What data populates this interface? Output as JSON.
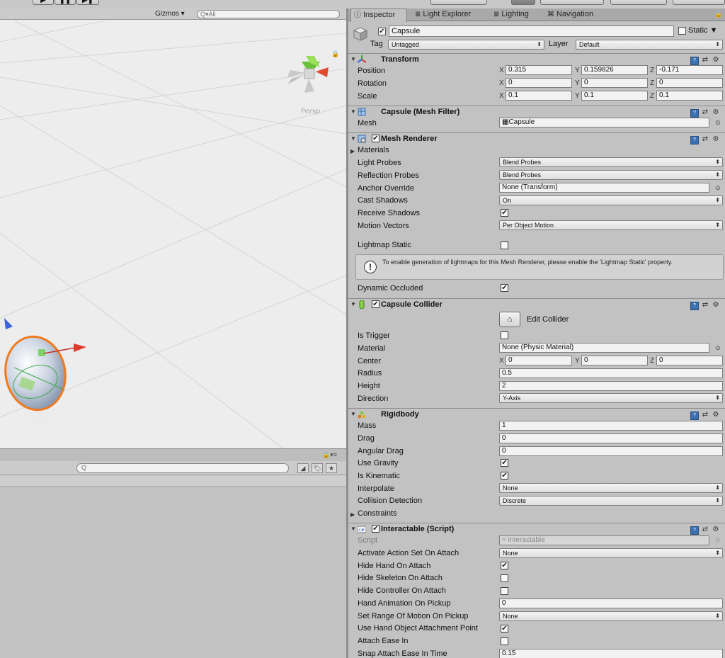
{
  "toolbar": {
    "play": "▶",
    "pause": "❚❚",
    "step": "▶❚"
  },
  "scene": {
    "gizmos_label": "Gizmos ▾",
    "search_placeholder": "All",
    "search_prefix": "Q▾",
    "persp_label": "Persp",
    "panel_menu": "▾≡"
  },
  "lower": {
    "lock": "🔒▾≡",
    "search_placeholder": "",
    "icons": [
      "◢",
      "🏷",
      "★"
    ]
  },
  "inspector": {
    "tabs": [
      {
        "icon": "ⓘ",
        "label": "Inspector"
      },
      {
        "icon": "≣",
        "label": "Light Explorer"
      },
      {
        "icon": "≣",
        "label": "Lighting"
      },
      {
        "icon": "⌘",
        "label": "Navigation"
      }
    ],
    "lock_icon": "🔒",
    "object": {
      "name": "Capsule",
      "active": true,
      "static_label": "Static",
      "static_checked": false,
      "tag_label": "Tag",
      "tag_value": "Untagged",
      "layer_label": "Layer",
      "layer_value": "Default"
    },
    "transform": {
      "title": "Transform",
      "position_label": "Position",
      "rotation_label": "Rotation",
      "scale_label": "Scale",
      "position": {
        "x": "0.315",
        "y": "0.159826",
        "z": "-0.171"
      },
      "rotation": {
        "x": "0",
        "y": "0",
        "z": "0"
      },
      "scale": {
        "x": "0.1",
        "y": "0.1",
        "z": "0.1"
      },
      "axis_x": "X",
      "axis_y": "Y",
      "axis_z": "Z"
    },
    "mesh_filter": {
      "title": "Capsule (Mesh Filter)",
      "mesh_label": "Mesh",
      "mesh_value": "Capsule"
    },
    "mesh_renderer": {
      "title": "Mesh Renderer",
      "enabled": true,
      "materials_label": "Materials",
      "light_probes_label": "Light Probes",
      "light_probes_value": "Blend Probes",
      "reflection_probes_label": "Reflection Probes",
      "reflection_probes_value": "Blend Probes",
      "anchor_override_label": "Anchor Override",
      "anchor_override_value": "None (Transform)",
      "cast_shadows_label": "Cast Shadows",
      "cast_shadows_value": "On",
      "receive_shadows_label": "Receive Shadows",
      "receive_shadows": true,
      "motion_vectors_label": "Motion Vectors",
      "motion_vectors_value": "Per Object Motion",
      "lightmap_static_label": "Lightmap Static",
      "lightmap_static": false,
      "help_text": "To enable generation of lightmaps for this Mesh Renderer, please enable the 'Lightmap Static' property.",
      "dynamic_occluded_label": "Dynamic Occluded",
      "dynamic_occluded": true
    },
    "capsule_collider": {
      "title": "Capsule Collider",
      "enabled": true,
      "edit_collider_label": "Edit Collider",
      "is_trigger_label": "Is Trigger",
      "is_trigger": false,
      "material_label": "Material",
      "material_value": "None (Physic Material)",
      "center_label": "Center",
      "center": {
        "x": "0",
        "y": "0",
        "z": "0"
      },
      "radius_label": "Radius",
      "radius_value": "0.5",
      "height_label": "Height",
      "height_value": "2",
      "direction_label": "Direction",
      "direction_value": "Y-Axis"
    },
    "rigidbody": {
      "title": "Rigidbody",
      "mass_label": "Mass",
      "mass_value": "1",
      "drag_label": "Drag",
      "drag_value": "0",
      "angular_drag_label": "Angular Drag",
      "angular_drag_value": "0",
      "use_gravity_label": "Use Gravity",
      "use_gravity": true,
      "is_kinematic_label": "Is Kinematic",
      "is_kinematic": true,
      "interpolate_label": "Interpolate",
      "interpolate_value": "None",
      "collision_detection_label": "Collision Detection",
      "collision_detection_value": "Discrete",
      "constraints_label": "Constraints"
    },
    "interactable": {
      "title": "Interactable (Script)",
      "enabled": true,
      "script_label": "Script",
      "script_value": "Interactable",
      "activate_action_label": "Activate Action Set On Attach",
      "activate_action_value": "None",
      "hide_hand_label": "Hide Hand On Attach",
      "hide_hand": true,
      "hide_skeleton_label": "Hide Skeleton On Attach",
      "hide_skeleton": false,
      "hide_controller_label": "Hide Controller On Attach",
      "hide_controller": false,
      "hand_anim_label": "Hand Animation On Pickup",
      "hand_anim_value": "0",
      "range_motion_label": "Set Range Of Motion On Pickup",
      "range_motion_value": "None",
      "use_attach_point_label": "Use Hand Object Attachment Point",
      "use_attach_point": true,
      "attach_ease_label": "Attach Ease In",
      "attach_ease": false,
      "snap_ease_label": "Snap Attach Ease In Time",
      "snap_ease_value": "0.15"
    }
  }
}
